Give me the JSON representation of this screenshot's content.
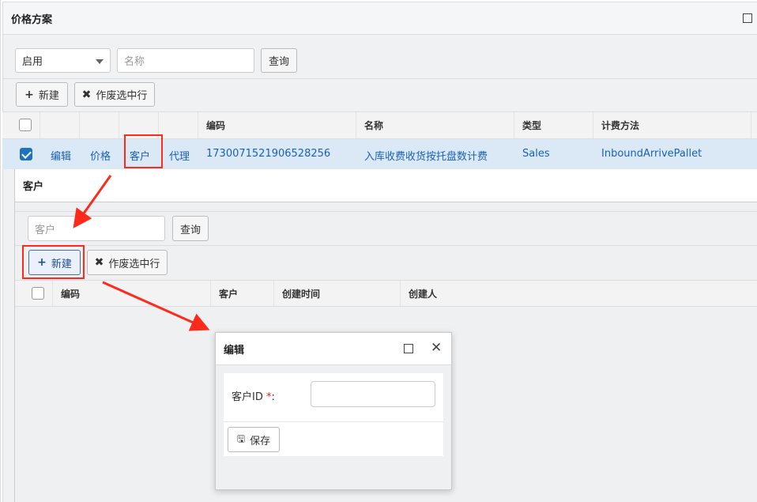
{
  "panel": {
    "title": "价格方案"
  },
  "filters": {
    "status_value": "启用",
    "name_placeholder": "名称",
    "query_label": "查询"
  },
  "toolbar": {
    "new_label": "新建",
    "void_label": "作废选中行"
  },
  "grid": {
    "columns": [
      "编码",
      "名称",
      "类型",
      "计费方法"
    ],
    "row": {
      "actions": [
        "编辑",
        "价格",
        "客户",
        "代理"
      ],
      "code": "1730071521906528256",
      "name": "入库收费收货按托盘数计费",
      "type": "Sales",
      "method": "InboundArrivePallet"
    }
  },
  "customer_dialog": {
    "title": "客户",
    "search_placeholder": "客户",
    "query_label": "查询",
    "new_label": "新建",
    "void_label": "作废选中行",
    "columns": [
      "编码",
      "客户",
      "创建时间",
      "创建人"
    ]
  },
  "edit_dialog": {
    "title": "编辑",
    "field_label": "客户ID",
    "required_mark": "*",
    "colon": ":",
    "save_label": "保存"
  },
  "colors": {
    "accent": "#1e73be",
    "link": "#1a62b5",
    "highlight": "#ff2a1a",
    "selected_row": "#dbe8f6"
  }
}
